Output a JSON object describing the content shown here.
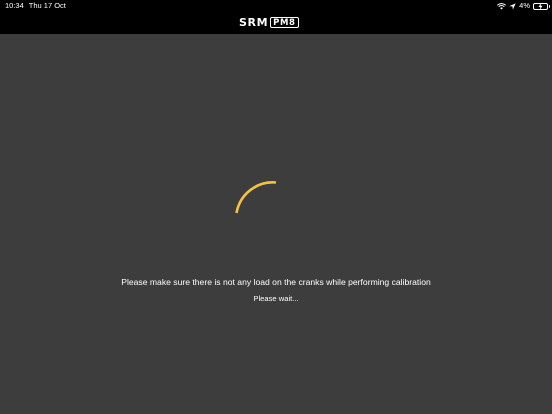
{
  "status_bar": {
    "time": "10:34",
    "date": "Thu 17 Oct",
    "battery_percent": "4%",
    "icons": [
      "wifi-icon",
      "location-arrow-icon",
      "battery-icon"
    ]
  },
  "header": {
    "logo_main": "SRM",
    "logo_badge": "PM8",
    "background_color": "#000000"
  },
  "main": {
    "background_color": "#3d3d3d",
    "spinner_color": "#f5c143",
    "message": "Please make sure there is not any load on the cranks while performing calibration",
    "wait_text": "Please wait..."
  }
}
